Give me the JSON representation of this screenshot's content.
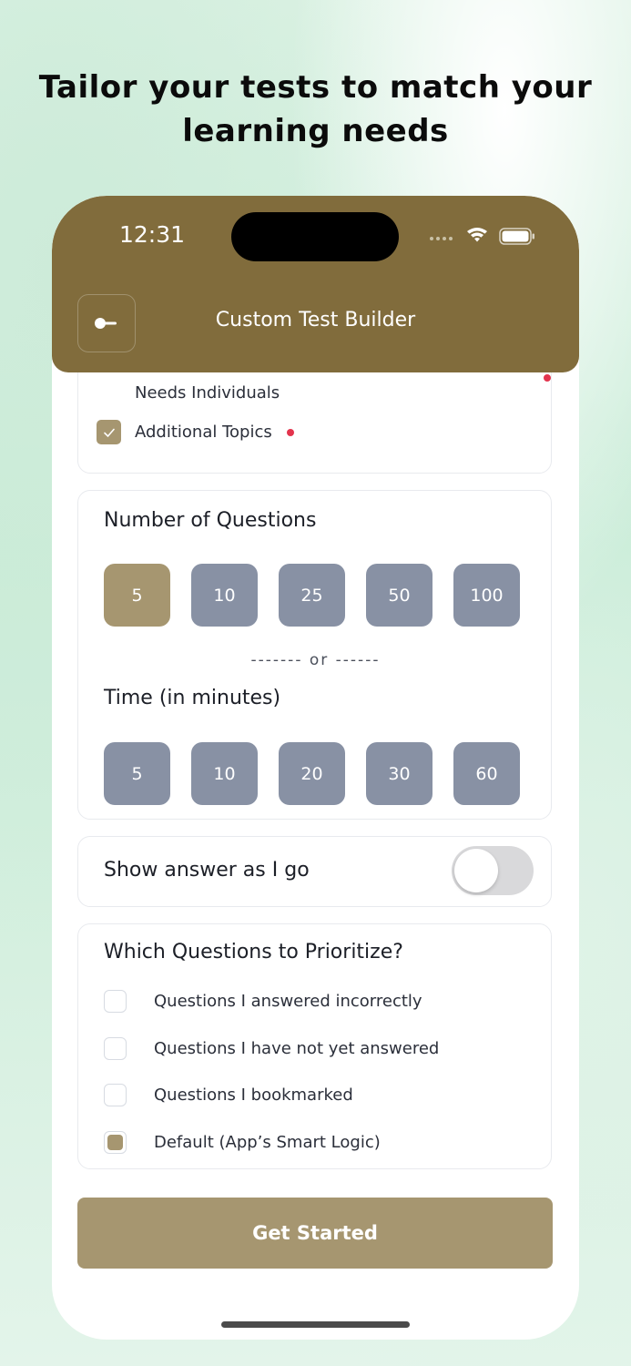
{
  "headline": {
    "line1": "Tailor your tests to match your",
    "line2": "learning needs"
  },
  "status_bar": {
    "time": "12:31"
  },
  "header": {
    "title": "Custom Test Builder",
    "back_icon": "back-arrow-icon"
  },
  "topics": [
    {
      "label": "Needs Individuals",
      "checked": true,
      "required": true
    },
    {
      "label": "Additional Topics",
      "checked": true,
      "required": true
    }
  ],
  "num_questions": {
    "title": "Number of Questions",
    "options": [
      "5",
      "10",
      "25",
      "50",
      "100"
    ],
    "selected": "5"
  },
  "divider_text": "------- or ------",
  "time_minutes": {
    "title": "Time (in minutes)",
    "options": [
      "5",
      "10",
      "20",
      "30",
      "60"
    ],
    "selected": null
  },
  "show_answer": {
    "label": "Show answer as I go",
    "enabled": false
  },
  "prioritize": {
    "title": "Which Questions to Prioritize?",
    "options": [
      {
        "label": "Questions I answered incorrectly",
        "checked": false
      },
      {
        "label": "Questions I have not yet answered",
        "checked": false
      },
      {
        "label": "Questions I bookmarked",
        "checked": false
      },
      {
        "label": "Default (App’s Smart Logic)",
        "checked": true
      }
    ]
  },
  "cta": {
    "label": "Get Started"
  },
  "colors": {
    "header": "#816c3c",
    "accent": "#a69670",
    "option_unselected": "#8891a4",
    "required_dot": "#e3344d"
  }
}
